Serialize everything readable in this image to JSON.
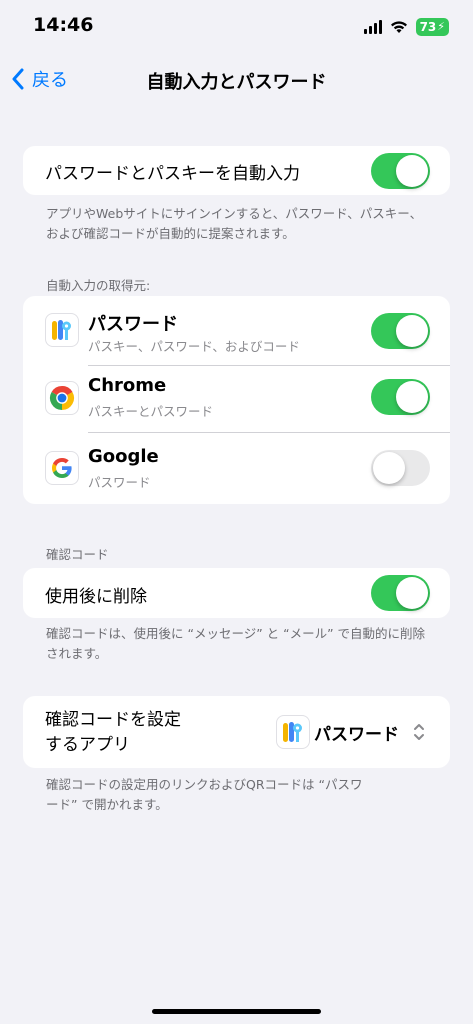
{
  "status": {
    "time": "14:46",
    "battery": "73"
  },
  "nav": {
    "back_label": "戻る",
    "title": "自動入力とパスワード"
  },
  "autofill": {
    "label": "パスワードとパスキーを自動入力",
    "enabled": true,
    "footnote": "アプリやWebサイトにサインインすると、パスワード、パスキー、および確認コードが自動的に提案されます。"
  },
  "sources": {
    "header": "自動入力の取得元:",
    "items": [
      {
        "title": "パスワード",
        "subtitle": "パスキー、パスワード、およびコード",
        "icon": "passwords-app-icon",
        "enabled": true
      },
      {
        "title": "Chrome",
        "subtitle": "パスキーとパスワード",
        "icon": "chrome-icon",
        "enabled": true
      },
      {
        "title": "Google",
        "subtitle": "パスワード",
        "icon": "google-icon",
        "enabled": false
      }
    ]
  },
  "verification": {
    "header": "確認コード",
    "delete_label": "使用後に削除",
    "delete_enabled": true,
    "footnote": "確認コードは、使用後に “メッセージ” と “メール” で自動的に削除されます。"
  },
  "setup": {
    "label_line1": "確認コードを設定",
    "label_line2": "するアプリ",
    "selected_app": "パスワード",
    "footnote": "確認コードの設定用のリンクおよびQRコードは “パスワード” で開かれます。"
  },
  "colors": {
    "accent": "#007aff",
    "toggle_on": "#34c759",
    "background": "#f2f2f7"
  }
}
